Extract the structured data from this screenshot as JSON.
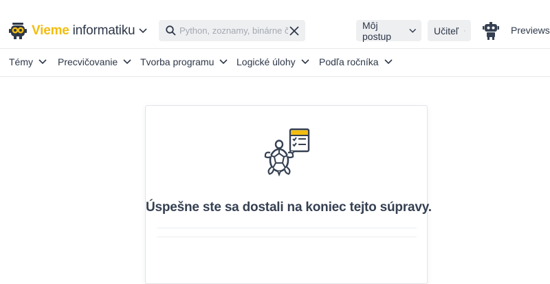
{
  "brand": {
    "word1": "Vieme",
    "word2": "informatiku",
    "logo_icon": "robot-logo-icon"
  },
  "search": {
    "placeholder": "Python, zoznamy, binárne č",
    "value": ""
  },
  "header": {
    "progress_label": "Môj postup",
    "role_label": "Učiteľ",
    "previews_label": "Previews"
  },
  "nav": {
    "items": [
      {
        "label": "Témy"
      },
      {
        "label": "Precvičovanie"
      },
      {
        "label": "Tvorba programu"
      },
      {
        "label": "Logické úlohy"
      },
      {
        "label": "Podľa ročníka"
      }
    ]
  },
  "card": {
    "message": "Úspešne ste sa dostali na koniec tejto súpravy.",
    "illustration": "turtle-checklist-icon"
  },
  "colors": {
    "accent": "#f2bd10",
    "text": "#2d3748",
    "pill_bg": "#eeeff1"
  }
}
